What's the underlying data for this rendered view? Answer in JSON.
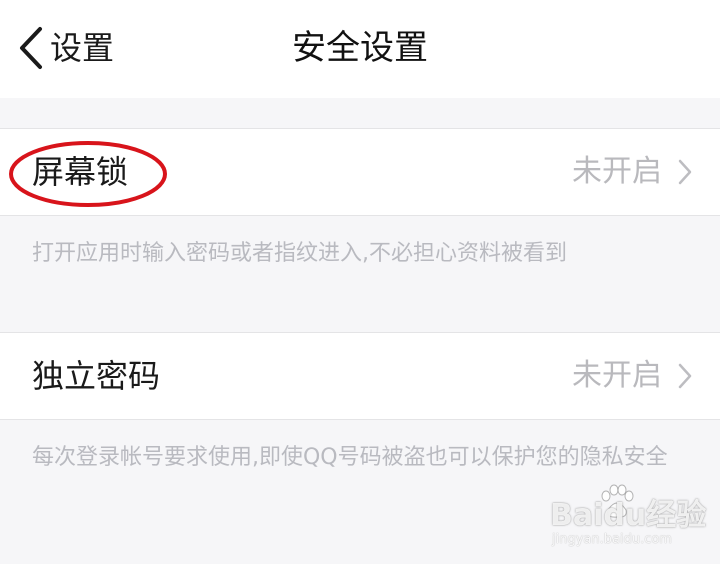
{
  "nav": {
    "back_label": "设置",
    "title": "安全设置"
  },
  "settings": [
    {
      "label": "屏幕锁",
      "value": "未开启",
      "description": "打开应用时输入密码或者指纹进入,不必担心资料被看到"
    },
    {
      "label": "独立密码",
      "value": "未开启",
      "description": "每次登录帐号要求使用,即使QQ号码被盗也可以保护您的隐私安全"
    }
  ],
  "watermark": {
    "brand": "Baidu经验",
    "url": "jingyan.baidu.com"
  },
  "colors": {
    "highlight": "#d8141b",
    "secondary_text": "#b9b9bd",
    "background": "#f6f6f8"
  }
}
